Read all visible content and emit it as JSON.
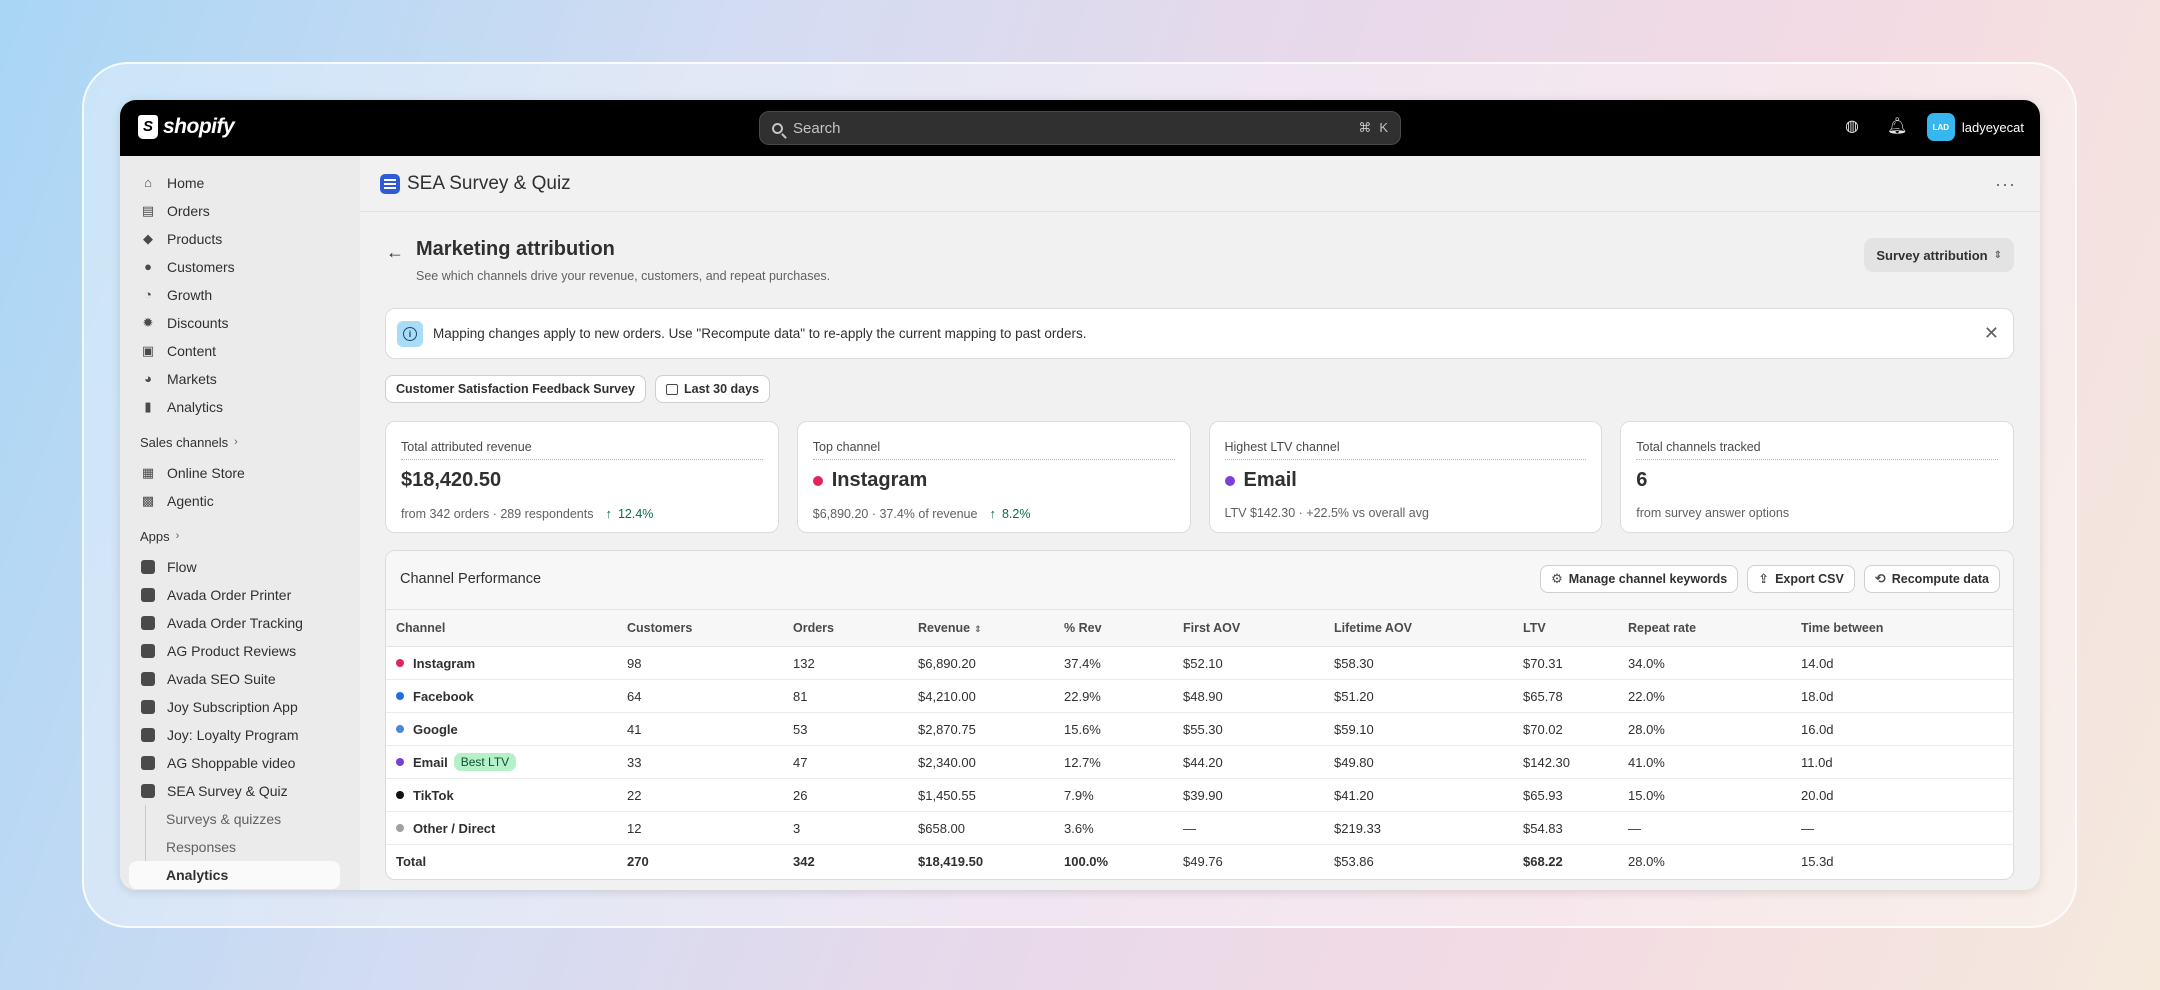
{
  "topbar": {
    "brand": "shopify",
    "search_placeholder": "Search",
    "shortcut_cmd": "⌘",
    "shortcut_key": "K",
    "user_initials": "LAD",
    "user_name": "ladyeyecat"
  },
  "sidebar": {
    "main_items": [
      {
        "label": "Home",
        "icon": "home-icon"
      },
      {
        "label": "Orders",
        "icon": "orders-icon"
      },
      {
        "label": "Products",
        "icon": "tag-icon"
      },
      {
        "label": "Customers",
        "icon": "person-icon"
      },
      {
        "label": "Growth",
        "icon": "growth-icon"
      },
      {
        "label": "Discounts",
        "icon": "discount-icon"
      },
      {
        "label": "Content",
        "icon": "content-icon"
      },
      {
        "label": "Markets",
        "icon": "globe-icon"
      },
      {
        "label": "Analytics",
        "icon": "bar-chart-icon"
      }
    ],
    "sales_channels_label": "Sales channels",
    "sales_channels": [
      {
        "label": "Online Store"
      },
      {
        "label": "Agentic"
      }
    ],
    "apps_label": "Apps",
    "apps": [
      {
        "label": "Flow"
      },
      {
        "label": "Avada Order Printer"
      },
      {
        "label": "Avada Order Tracking"
      },
      {
        "label": "AG Product Reviews"
      },
      {
        "label": "Avada SEO Suite"
      },
      {
        "label": "Joy Subscription App"
      },
      {
        "label": "Joy: Loyalty Program"
      },
      {
        "label": "AG Shoppable video"
      },
      {
        "label": "SEA Survey & Quiz"
      }
    ],
    "sub_items": [
      {
        "label": "Surveys & quizzes"
      },
      {
        "label": "Responses"
      },
      {
        "label": "Analytics"
      }
    ]
  },
  "app_header": {
    "title": "SEA Survey & Quiz"
  },
  "page": {
    "title": "Marketing attribution",
    "subtitle": "See which channels drive your revenue, customers, and repeat purchases.",
    "attribution_button": "Survey attribution"
  },
  "banner": {
    "text": "Mapping changes apply to new orders. Use \"Recompute data\" to re-apply the current mapping to past orders."
  },
  "filters": {
    "survey": "Customer Satisfaction Feedback Survey",
    "date_range": "Last 30 days"
  },
  "kpis": [
    {
      "label": "Total attributed revenue",
      "value": "$18,420.50",
      "meta": "from 342 orders · 289 respondents",
      "trend": "12.4%",
      "dot_color": ""
    },
    {
      "label": "Top channel",
      "value": "Instagram",
      "meta": "$6,890.20 · 37.4% of revenue",
      "trend": "8.2%",
      "dot_color": "#e3245c"
    },
    {
      "label": "Highest LTV channel",
      "value": "Email",
      "meta": "LTV $142.30 · +22.5% vs overall avg",
      "trend": "",
      "dot_color": "#7b3ed6"
    },
    {
      "label": "Total channels tracked",
      "value": "6",
      "meta": "from survey answer options",
      "trend": "",
      "dot_color": ""
    }
  ],
  "table": {
    "title": "Channel Performance",
    "actions": {
      "manage": "Manage channel keywords",
      "export": "Export CSV",
      "recompute": "Recompute data"
    },
    "columns": [
      "Channel",
      "Customers",
      "Orders",
      "Revenue",
      "% Rev",
      "First AOV",
      "Lifetime AOV",
      "LTV",
      "Repeat rate",
      "Time between"
    ],
    "rows": [
      {
        "channel": "Instagram",
        "color": "#e3245c",
        "badge": "",
        "customers": "98",
        "orders": "132",
        "revenue": "$6,890.20",
        "pct": "37.4%",
        "first_aov": "$52.10",
        "lifetime_aov": "$58.30",
        "ltv": "$70.31",
        "repeat": "34.0%",
        "time": "14.0d"
      },
      {
        "channel": "Facebook",
        "color": "#1f6fe0",
        "badge": "",
        "customers": "64",
        "orders": "81",
        "revenue": "$4,210.00",
        "pct": "22.9%",
        "first_aov": "$48.90",
        "lifetime_aov": "$51.20",
        "ltv": "$65.78",
        "repeat": "22.0%",
        "time": "18.0d"
      },
      {
        "channel": "Google",
        "color": "#4a86e0",
        "badge": "",
        "customers": "41",
        "orders": "53",
        "revenue": "$2,870.75",
        "pct": "15.6%",
        "first_aov": "$55.30",
        "lifetime_aov": "$59.10",
        "ltv": "$70.02",
        "repeat": "28.0%",
        "time": "16.0d"
      },
      {
        "channel": "Email",
        "color": "#7b3ed6",
        "badge": "Best LTV",
        "customers": "33",
        "orders": "47",
        "revenue": "$2,340.00",
        "pct": "12.7%",
        "first_aov": "$44.20",
        "lifetime_aov": "$49.80",
        "ltv": "$142.30",
        "repeat": "41.0%",
        "time": "11.0d"
      },
      {
        "channel": "TikTok",
        "color": "#111111",
        "badge": "",
        "customers": "22",
        "orders": "26",
        "revenue": "$1,450.55",
        "pct": "7.9%",
        "first_aov": "$39.90",
        "lifetime_aov": "$41.20",
        "ltv": "$65.93",
        "repeat": "15.0%",
        "time": "20.0d"
      },
      {
        "channel": "Other / Direct",
        "color": "#a0a0a8",
        "badge": "",
        "customers": "12",
        "orders": "3",
        "revenue": "$658.00",
        "pct": "3.6%",
        "first_aov": "—",
        "lifetime_aov": "$219.33",
        "ltv": "$54.83",
        "repeat": "—",
        "time": "—"
      }
    ],
    "total": {
      "channel": "Total",
      "customers": "270",
      "orders": "342",
      "revenue": "$18,419.50",
      "pct": "100.0%",
      "first_aov": "$49.76",
      "lifetime_aov": "$53.86",
      "ltv": "$68.22",
      "repeat": "28.0%",
      "time": "15.3d"
    }
  }
}
